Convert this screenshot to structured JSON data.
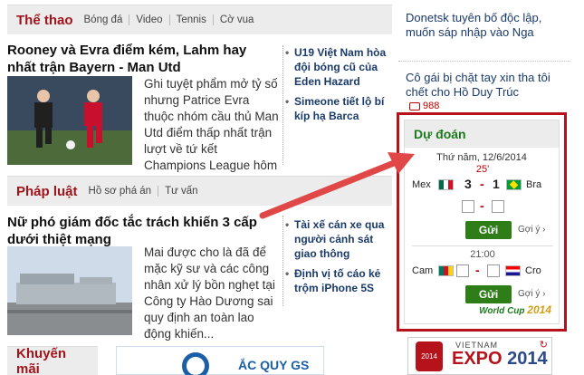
{
  "sports": {
    "title": "Thể thao",
    "subnav": [
      "Bóng đá",
      "Video",
      "Tennis",
      "Cờ vua"
    ],
    "headline": "Rooney và Evra điểm kém, Lahm hay nhất trận Bayern - Man Utd",
    "summary": "Ghi tuyệt phẩm mở tỷ số nhưng Patrice Evra thuộc nhóm cầu thủ Man Utd điểm thấp nhất trận lượt về tứ kết Champions League hôm qua.",
    "side_items": [
      "U19 Việt Nam hòa đội bóng cũ của Eden Hazard",
      "Simeone tiết lộ bí kíp hạ Barca"
    ]
  },
  "law": {
    "title": "Pháp luật",
    "subnav": [
      "Hồ sơ phá án",
      "Tư vấn"
    ],
    "headline": "Nữ phó giám đốc tắc trách khiến 3 cấp dưới thiệt mạng",
    "summary": "Mai được cho là đã để mặc kỹ sư và các công nhân xử lý bồn nghẹt tại Công ty Hào Dương sai quy định an toàn lao động khiến...",
    "side_items": [
      "Tài xế cán xe qua người cảnh sát giao thông",
      "Định vị tố cáo kẻ trộm iPhone 5S"
    ]
  },
  "promo": {
    "title": "Khuyến mãi",
    "banner_text": "ẮC QUY GS"
  },
  "right_news": {
    "item1": "Donetsk tuyên bố độc lập, muốn sáp nhập vào Nga",
    "item2": "Cô gái bị chặt tay xin tha tôi chết cho Hồ Duy Trúc",
    "comments": "988"
  },
  "predict": {
    "title": "Dự đoán",
    "date": "Thứ năm, 12/6/2014",
    "match1": {
      "minute": "25'",
      "home": "Mex",
      "away": "Bra",
      "home_score": "3",
      "away_score": "1",
      "submit": "Gửi",
      "hint": "Gợi ý"
    },
    "match2": {
      "time": "21:00",
      "home": "Cam",
      "away": "Cro",
      "submit": "Gửi",
      "hint": "Gợi ý"
    },
    "logo_text": "World Cup",
    "logo_year": "2014"
  },
  "expo": {
    "top": "VIETNAM",
    "main": "EXPO",
    "year": "2014",
    "badge": "2014"
  },
  "colors": {
    "accent": "#a0131a",
    "green": "#2e7d19",
    "link": "#1a3a6b"
  }
}
